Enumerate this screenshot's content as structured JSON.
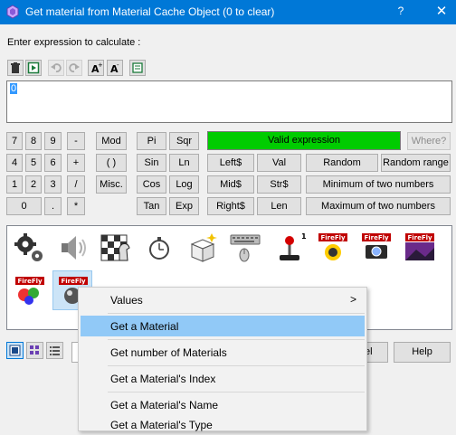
{
  "window": {
    "title": "Get material from Material Cache Object (0 to clear)",
    "help_label": "?",
    "close_label": "✕"
  },
  "prompt": "Enter expression to calculate :",
  "toolbar": {
    "icons": [
      "trash-icon",
      "insert-icon",
      "undo-icon",
      "redo-icon",
      "font-increase-icon",
      "font-decrease-icon",
      "calculator-icon"
    ],
    "font_increase_label": "A",
    "font_decrease_label": "A"
  },
  "expression": {
    "value": "0"
  },
  "keypad": {
    "digits_row1": [
      "7",
      "8",
      "9",
      "-"
    ],
    "digits_row2": [
      "4",
      "5",
      "6",
      "+"
    ],
    "digits_row3": [
      "1",
      "2",
      "3",
      "/"
    ],
    "digits_row4": [
      "0",
      ".",
      "*"
    ],
    "mod": "Mod",
    "parens": "( )",
    "misc": "Misc.",
    "pi": "Pi",
    "sqr": "Sqr",
    "sin": "Sin",
    "ln": "Ln",
    "cos": "Cos",
    "log": "Log",
    "tan": "Tan",
    "exp": "Exp",
    "left": "Left$",
    "val": "Val",
    "random": "Random",
    "random_range": "Random range",
    "mid": "Mid$",
    "str": "Str$",
    "min_two": "Minimum of two numbers",
    "right": "Right$",
    "len": "Len",
    "max_two": "Maximum of two numbers"
  },
  "status": {
    "valid_text": "Valid expression",
    "valid_color": "#00cc00",
    "where_label": "Where?"
  },
  "palette": {
    "objects": [
      "gears-icon",
      "speaker-icon",
      "chess-board-icon",
      "stopwatch-icon",
      "magic-box-icon",
      "keyboard-mouse-icon",
      "joystick-icon",
      "firefly-gear-icon",
      "firefly-camera-icon",
      "firefly-landscape-icon",
      "firefly-colors-icon",
      "firefly-material-icon"
    ],
    "joystick_badge": "1",
    "firefly_label": "FireFly"
  },
  "bottom": {
    "cancel_label": "Cancel",
    "help_label": "Help"
  },
  "context_menu": {
    "items": [
      {
        "label": "Values",
        "submenu": ">"
      },
      {
        "label": "Get a Material"
      },
      {
        "label": "Get number of Materials"
      },
      {
        "label": "Get a Material's Index"
      },
      {
        "label": "Get a Material's Name"
      },
      {
        "label": "Get a Material's Type"
      }
    ]
  },
  "colors": {
    "titlebar": "#0078d7",
    "highlight": "#91c9f7",
    "selection": "#3399ff"
  }
}
